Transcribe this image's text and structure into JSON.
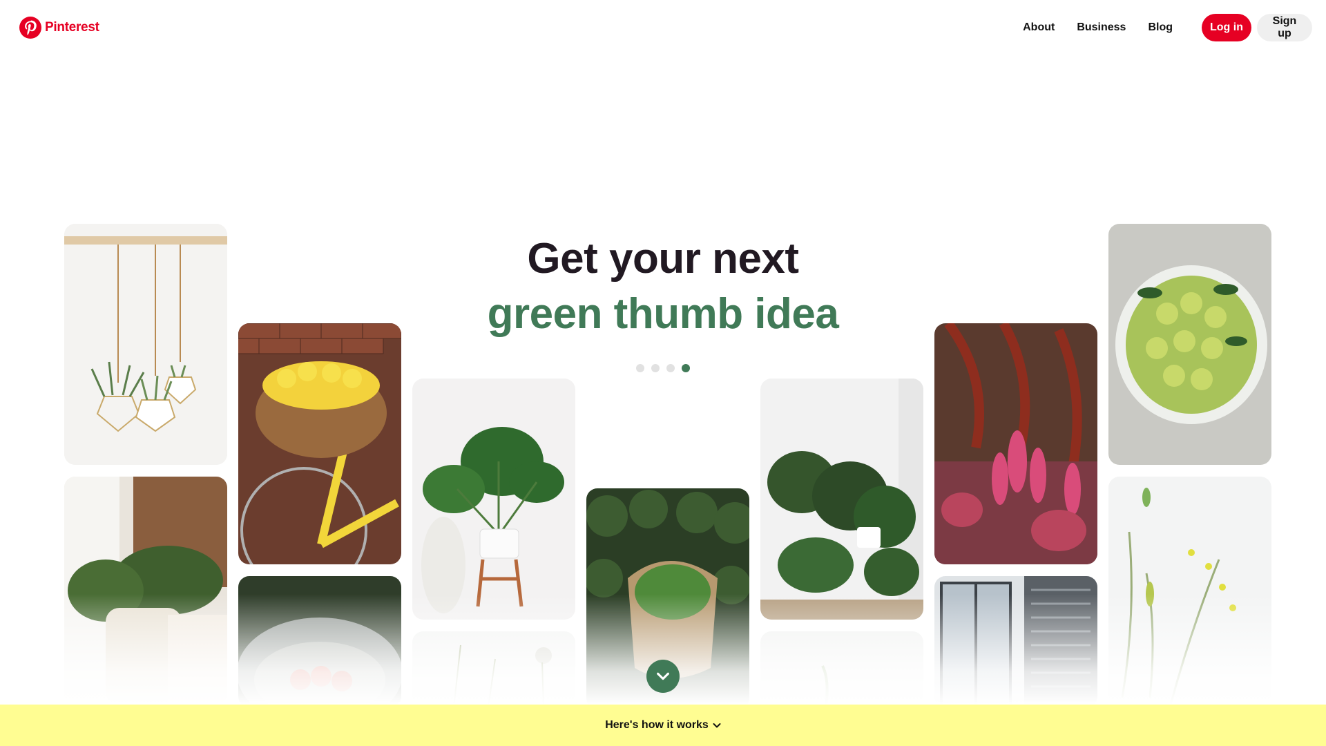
{
  "brand": {
    "name": "Pinterest",
    "color": "#e60023"
  },
  "nav": {
    "about": "About",
    "business": "Business",
    "blog": "Blog",
    "login": "Log in",
    "signup": "Sign up"
  },
  "hero": {
    "line1": "Get your next",
    "line2": "green thumb idea",
    "accent_color": "#407a57",
    "carousel_dots": 4,
    "active_dot": 4
  },
  "pins": [
    {
      "subject": "hanging air plants in geometric planters"
    },
    {
      "subject": "kale in tote bag"
    },
    {
      "subject": "yellow bicycle with tulip basket"
    },
    {
      "subject": "apples in metal tub"
    },
    {
      "subject": "monstera plant on stand"
    },
    {
      "subject": "pressed flowers"
    },
    {
      "subject": "leafy greens in paper bag"
    },
    {
      "subject": "indoor plant collection"
    },
    {
      "subject": "small plant on white"
    },
    {
      "subject": "red and pink garden flowers"
    },
    {
      "subject": "window with shutters"
    },
    {
      "subject": "green pears in bowl"
    },
    {
      "subject": "botanical flowers on white"
    }
  ],
  "scroll_button": {
    "icon": "chevron-down-icon"
  },
  "footer": {
    "label": "Here's how it works",
    "icon": "chevron-down-icon",
    "bg": "#fffd92"
  }
}
